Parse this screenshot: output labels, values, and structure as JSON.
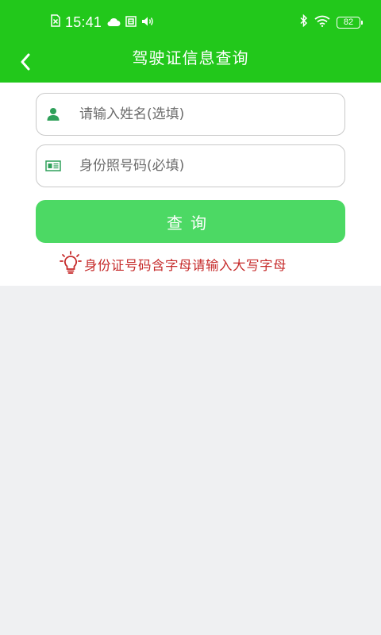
{
  "status_bar": {
    "time": "15:41",
    "battery_level": "82",
    "icons": [
      "sim-error-icon",
      "weather-icon",
      "notification-icon",
      "volume-icon",
      "bluetooth-icon",
      "wifi-icon",
      "battery-icon"
    ]
  },
  "header": {
    "title": "驾驶证信息查询",
    "back_icon": "back-chevron-icon"
  },
  "form": {
    "name_placeholder": "请输入姓名(选填)",
    "name_value": "",
    "id_placeholder": "身份照号码(必填)",
    "id_value": "",
    "query_label": "查询"
  },
  "tip": {
    "text": "身份证号码含字母请输入大写字母",
    "icon": "lightbulb-icon"
  },
  "colors": {
    "brand_green": "#22c81b",
    "button_green": "#4cd964",
    "tip_red": "#c62b2b",
    "background": "#eff0f2"
  }
}
